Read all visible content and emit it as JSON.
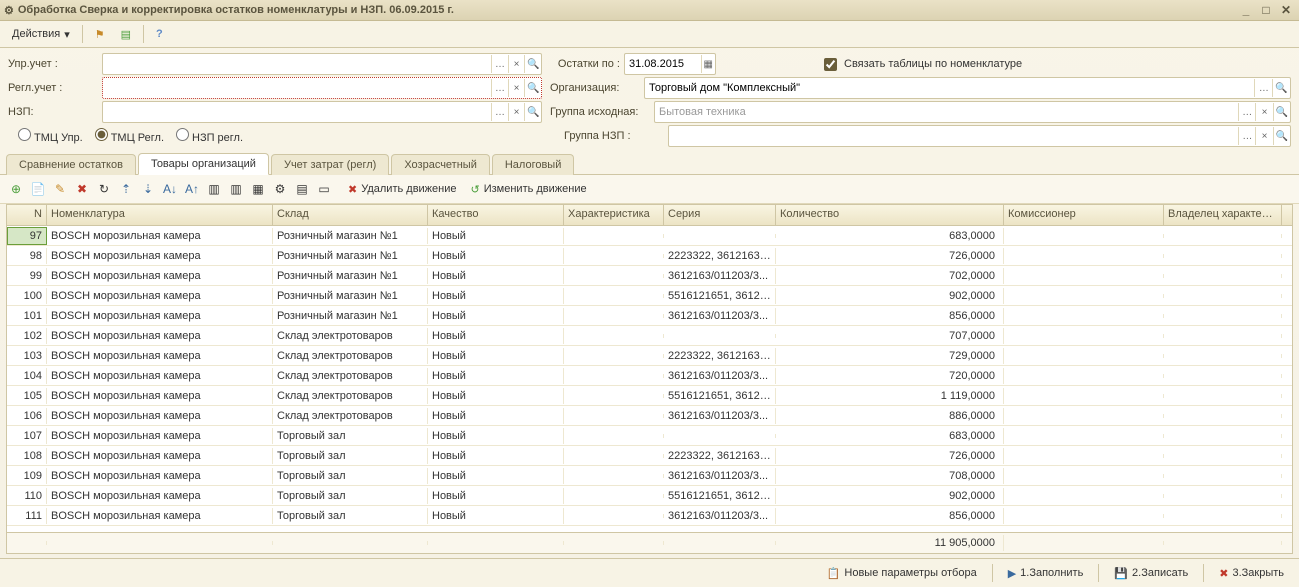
{
  "window": {
    "title": "Обработка  Сверка и корректировка остатков номенклатуры и НЗП. 06.09.2015 г."
  },
  "toolbar": {
    "actions_label": "Действия"
  },
  "form": {
    "upr_label": "Упр.учет :",
    "regl_label": "Регл.учет :",
    "nzp_label": "НЗП:",
    "ostatki_label": "Остатки по :",
    "ostatki_value": "31.08.2015",
    "org_label": "Организация:",
    "org_value": "Торговый дом \"Комплексный\"",
    "group_ish_label": "Группа исходная:",
    "group_ish_value": "Бытовая техника",
    "group_nzp_label": "Группа НЗП :",
    "link_tables_label": "Связать таблицы по номенклатуре",
    "radio_tmc_upr": "ТМЦ Упр.",
    "radio_tmc_regl": "ТМЦ Регл.",
    "radio_nzp_regl": "НЗП регл."
  },
  "tabs": [
    {
      "label": "Сравнение остатков"
    },
    {
      "label": "Товары организаций"
    },
    {
      "label": "Учет затрат (регл)"
    },
    {
      "label": "Хозрасчетный"
    },
    {
      "label": "Налоговый"
    }
  ],
  "subtoolbar": {
    "delete_move": "Удалить движение",
    "edit_move": "Изменить движение"
  },
  "table": {
    "headers": {
      "n": "N",
      "nom": "Номенклатура",
      "sklad": "Склад",
      "kach": "Качество",
      "har": "Характеристика",
      "ser": "Серия",
      "kol": "Количество",
      "kom": "Комиссионер",
      "vlad": "Владелец характери..."
    },
    "rows": [
      {
        "n": "97",
        "nom": "BOSCH морозильная камера",
        "sklad": "Розничный магазин №1",
        "kach": "Новый",
        "ser": "",
        "kol": "683,0000"
      },
      {
        "n": "98",
        "nom": "BOSCH морозильная камера",
        "sklad": "Розничный магазин №1",
        "kach": "Новый",
        "ser": "2223322, 3612163/...",
        "kol": "726,0000"
      },
      {
        "n": "99",
        "nom": "BOSCH морозильная камера",
        "sklad": "Розничный магазин №1",
        "kach": "Новый",
        "ser": "3612163/011203/3...",
        "kol": "702,0000"
      },
      {
        "n": "100",
        "nom": "BOSCH морозильная камера",
        "sklad": "Розничный магазин №1",
        "kach": "Новый",
        "ser": "5516121651, 36121...",
        "kol": "902,0000"
      },
      {
        "n": "101",
        "nom": "BOSCH морозильная камера",
        "sklad": "Розничный магазин №1",
        "kach": "Новый",
        "ser": "3612163/011203/3...",
        "kol": "856,0000"
      },
      {
        "n": "102",
        "nom": "BOSCH морозильная камера",
        "sklad": "Склад электротоваров",
        "kach": "Новый",
        "ser": "",
        "kol": "707,0000"
      },
      {
        "n": "103",
        "nom": "BOSCH морозильная камера",
        "sklad": "Склад электротоваров",
        "kach": "Новый",
        "ser": "2223322, 3612163/...",
        "kol": "729,0000"
      },
      {
        "n": "104",
        "nom": "BOSCH морозильная камера",
        "sklad": "Склад электротоваров",
        "kach": "Новый",
        "ser": "3612163/011203/3...",
        "kol": "720,0000"
      },
      {
        "n": "105",
        "nom": "BOSCH морозильная камера",
        "sklad": "Склад электротоваров",
        "kach": "Новый",
        "ser": "5516121651, 36121...",
        "kol": "1 119,0000"
      },
      {
        "n": "106",
        "nom": "BOSCH морозильная камера",
        "sklad": "Склад электротоваров",
        "kach": "Новый",
        "ser": "3612163/011203/3...",
        "kol": "886,0000"
      },
      {
        "n": "107",
        "nom": "BOSCH морозильная камера",
        "sklad": "Торговый зал",
        "kach": "Новый",
        "ser": "",
        "kol": "683,0000"
      },
      {
        "n": "108",
        "nom": "BOSCH морозильная камера",
        "sklad": "Торговый зал",
        "kach": "Новый",
        "ser": "2223322, 3612163/...",
        "kol": "726,0000"
      },
      {
        "n": "109",
        "nom": "BOSCH морозильная камера",
        "sklad": "Торговый зал",
        "kach": "Новый",
        "ser": "3612163/011203/3...",
        "kol": "708,0000"
      },
      {
        "n": "110",
        "nom": "BOSCH морозильная камера",
        "sklad": "Торговый зал",
        "kach": "Новый",
        "ser": "5516121651, 36121...",
        "kol": "902,0000"
      },
      {
        "n": "111",
        "nom": "BOSCH морозильная камера",
        "sklad": "Торговый зал",
        "kach": "Новый",
        "ser": "3612163/011203/3...",
        "kol": "856,0000"
      }
    ],
    "total": "11 905,0000"
  },
  "footer": {
    "new_params": "Новые параметры отбора",
    "fill": "1.Заполнить",
    "save": "2.Записать",
    "close": "3.Закрыть"
  }
}
